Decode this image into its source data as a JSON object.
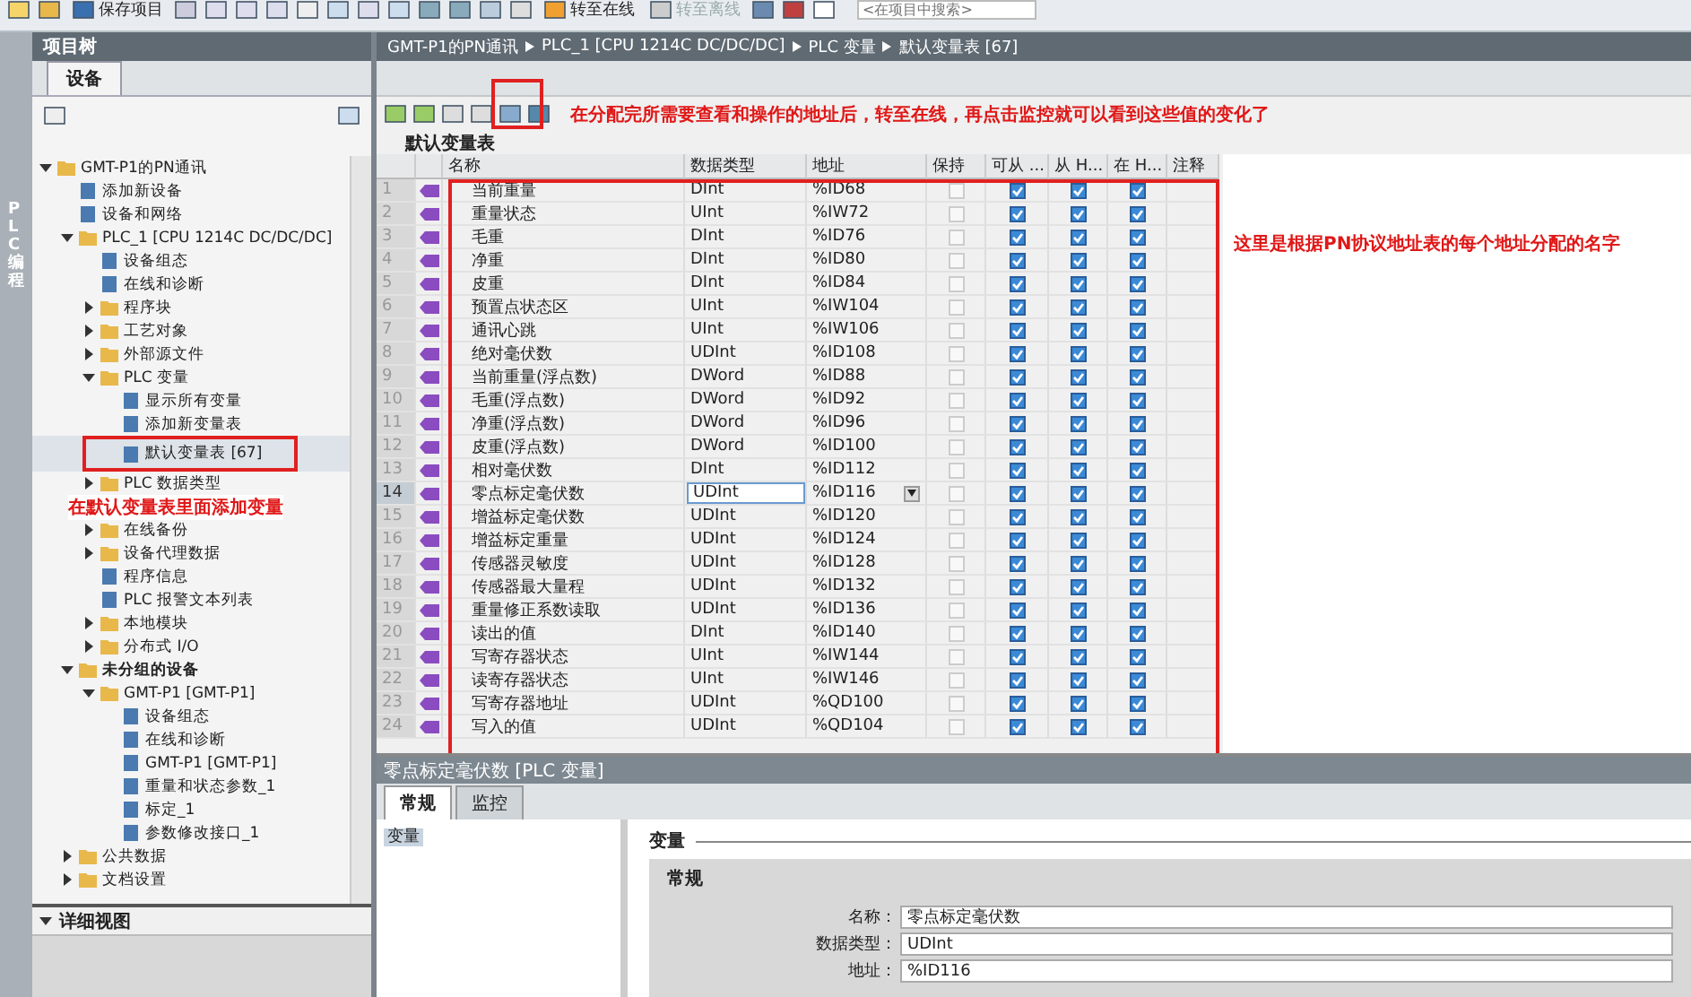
{
  "toolbar": {
    "save_label": "保存项目",
    "online_label": "转至在线",
    "offline": {
      "label": "转至离线",
      "disabled": true
    },
    "search": {
      "placeholder": "<在项目中搜索>"
    }
  },
  "side_strip": {
    "label": "PLC 编程"
  },
  "project_tree": {
    "title": "项目树",
    "tab": {
      "label": "设备",
      "selected": true
    },
    "items": [
      {
        "label": "GMT-P1的PN通讯",
        "expanded": true,
        "children": [
          {
            "label": "添加新设备"
          },
          {
            "label": "设备和网络"
          },
          {
            "label": "PLC_1 [CPU 1214C DC/DC/DC]",
            "expanded": true,
            "children": [
              {
                "label": "设备组态"
              },
              {
                "label": "在线和诊断"
              },
              {
                "label": "程序块",
                "expanded": false
              },
              {
                "label": "工艺对象",
                "expanded": false
              },
              {
                "label": "外部源文件",
                "expanded": false
              },
              {
                "label": "PLC 变量",
                "expanded": true,
                "children": [
                  {
                    "label": "显示所有变量"
                  },
                  {
                    "label": "添加新变量表"
                  },
                  {
                    "label": "默认变量表 [67]",
                    "selected": true
                  }
                ]
              },
              {
                "label": "PLC 数据类型",
                "expanded": false
              },
              {
                "kind": "note",
                "label": "在默认变量表里面添加变量"
              },
              {
                "label": "在线备份",
                "expanded": false
              },
              {
                "label": "设备代理数据",
                "expanded": false
              },
              {
                "label": "程序信息"
              },
              {
                "label": "PLC 报警文本列表"
              },
              {
                "label": "本地模块",
                "expanded": false
              },
              {
                "label": "分布式 I/O",
                "expanded": false
              }
            ]
          },
          {
            "label": "未分组的设备",
            "expanded": true,
            "bold": true,
            "children": [
              {
                "label": "GMT-P1 [GMT-P1]",
                "expanded": true,
                "children": [
                  {
                    "label": "设备组态"
                  },
                  {
                    "label": "在线和诊断"
                  },
                  {
                    "label": "GMT-P1 [GMT-P1]"
                  },
                  {
                    "label": "重量和状态参数_1"
                  },
                  {
                    "label": "标定_1"
                  },
                  {
                    "label": "参数修改接口_1"
                  }
                ]
              }
            ]
          },
          {
            "label": "公共数据",
            "expanded": false
          },
          {
            "label": "文档设置",
            "expanded": false
          }
        ]
      }
    ],
    "detail_view": {
      "title": "详细视图",
      "expanded": true
    }
  },
  "breadcrumb": [
    "GMT-P1的PN通讯",
    "PLC_1 [CPU 1214C DC/DC/DC]",
    "PLC 变量",
    "默认变量表 [67]"
  ],
  "table": {
    "title": "默认变量表",
    "columns": [
      "名称",
      "数据类型",
      "地址",
      "保持",
      "可从 ...",
      "从 H...",
      "在 H...",
      "注释"
    ],
    "rows": [
      {
        "num": "1",
        "name": "当前重量",
        "type": "DInt",
        "address": "%ID68",
        "retain": false,
        "accessible": true,
        "writable": true,
        "visible": true,
        "selected": false
      },
      {
        "num": "2",
        "name": "重量状态",
        "type": "UInt",
        "address": "%IW72",
        "retain": false,
        "accessible": true,
        "writable": true,
        "visible": true,
        "selected": false
      },
      {
        "num": "3",
        "name": "毛重",
        "type": "DInt",
        "address": "%ID76",
        "retain": false,
        "accessible": true,
        "writable": true,
        "visible": true,
        "selected": false
      },
      {
        "num": "4",
        "name": "净重",
        "type": "DInt",
        "address": "%ID80",
        "retain": false,
        "accessible": true,
        "writable": true,
        "visible": true,
        "selected": false
      },
      {
        "num": "5",
        "name": "皮重",
        "type": "DInt",
        "address": "%ID84",
        "retain": false,
        "accessible": true,
        "writable": true,
        "visible": true,
        "selected": false
      },
      {
        "num": "6",
        "name": "预置点状态区",
        "type": "UInt",
        "address": "%IW104",
        "retain": false,
        "accessible": true,
        "writable": true,
        "visible": true,
        "selected": false
      },
      {
        "num": "7",
        "name": "通讯心跳",
        "type": "UInt",
        "address": "%IW106",
        "retain": false,
        "accessible": true,
        "writable": true,
        "visible": true,
        "selected": false
      },
      {
        "num": "8",
        "name": "绝对毫伏数",
        "type": "UDInt",
        "address": "%ID108",
        "retain": false,
        "accessible": true,
        "writable": true,
        "visible": true,
        "selected": false
      },
      {
        "num": "9",
        "name": "当前重量(浮点数)",
        "type": "DWord",
        "address": "%ID88",
        "retain": false,
        "accessible": true,
        "writable": true,
        "visible": true,
        "selected": false
      },
      {
        "num": "10",
        "name": "毛重(浮点数)",
        "type": "DWord",
        "address": "%ID92",
        "retain": false,
        "accessible": true,
        "writable": true,
        "visible": true,
        "selected": false
      },
      {
        "num": "11",
        "name": "净重(浮点数)",
        "type": "DWord",
        "address": "%ID96",
        "retain": false,
        "accessible": true,
        "writable": true,
        "visible": true,
        "selected": false
      },
      {
        "num": "12",
        "name": "皮重(浮点数)",
        "type": "DWord",
        "address": "%ID100",
        "retain": false,
        "accessible": true,
        "writable": true,
        "visible": true,
        "selected": false
      },
      {
        "num": "13",
        "name": "相对毫伏数",
        "type": "DInt",
        "address": "%ID112",
        "retain": false,
        "accessible": true,
        "writable": true,
        "visible": true,
        "selected": false
      },
      {
        "num": "14",
        "name": "零点标定毫伏数",
        "type": "UDInt",
        "address": "%ID116",
        "retain": false,
        "accessible": true,
        "writable": true,
        "visible": true,
        "selected": true
      },
      {
        "num": "15",
        "name": "增益标定毫伏数",
        "type": "UDInt",
        "address": "%ID120",
        "retain": false,
        "accessible": true,
        "writable": true,
        "visible": true,
        "selected": false
      },
      {
        "num": "16",
        "name": "增益标定重量",
        "type": "UDInt",
        "address": "%ID124",
        "retain": false,
        "accessible": true,
        "writable": true,
        "visible": true,
        "selected": false
      },
      {
        "num": "17",
        "name": "传感器灵敏度",
        "type": "UDInt",
        "address": "%ID128",
        "retain": false,
        "accessible": true,
        "writable": true,
        "visible": true,
        "selected": false
      },
      {
        "num": "18",
        "name": "传感器最大量程",
        "type": "UDInt",
        "address": "%ID132",
        "retain": false,
        "accessible": true,
        "writable": true,
        "visible": true,
        "selected": false
      },
      {
        "num": "19",
        "name": "重量修正系数读取",
        "type": "UDInt",
        "address": "%ID136",
        "retain": false,
        "accessible": true,
        "writable": true,
        "visible": true,
        "selected": false
      },
      {
        "num": "20",
        "name": "读出的值",
        "type": "DInt",
        "address": "%ID140",
        "retain": false,
        "accessible": true,
        "writable": true,
        "visible": true,
        "selected": false
      },
      {
        "num": "21",
        "name": "写寄存器状态",
        "type": "UInt",
        "address": "%IW144",
        "retain": false,
        "accessible": true,
        "writable": true,
        "visible": true,
        "selected": false
      },
      {
        "num": "22",
        "name": "读寄存器状态",
        "type": "UInt",
        "address": "%IW146",
        "retain": false,
        "accessible": true,
        "writable": true,
        "visible": true,
        "selected": false
      },
      {
        "num": "23",
        "name": "写寄存器地址",
        "type": "UDInt",
        "address": "%QD100",
        "retain": false,
        "accessible": true,
        "writable": true,
        "visible": true,
        "selected": false
      },
      {
        "num": "24",
        "name": "写入的值",
        "type": "UDInt",
        "address": "%QD104",
        "retain": false,
        "accessible": true,
        "writable": true,
        "visible": true,
        "selected": false
      }
    ]
  },
  "properties": {
    "title": "零点标定毫伏数 [PLC 变量]",
    "tabs": [
      {
        "label": "常规",
        "selected": true
      },
      {
        "label": "监控",
        "selected": false
      }
    ],
    "nav": [
      {
        "label": "变量",
        "selected": true
      }
    ],
    "section": "变量",
    "subsection": "常规",
    "fields": [
      {
        "label": "名称：",
        "value": "零点标定毫伏数"
      },
      {
        "label": "数据类型：",
        "value": "UDInt"
      },
      {
        "label": "地址：",
        "value": "%ID116"
      }
    ]
  },
  "annotations": [
    {
      "text": "在分配完所需要查看和操作的地址后，转至在线，再点击监控就可以看到这些值的变化了"
    },
    {
      "text": "这里是根据PN协议地址表的每个地址分配的名字"
    }
  ]
}
